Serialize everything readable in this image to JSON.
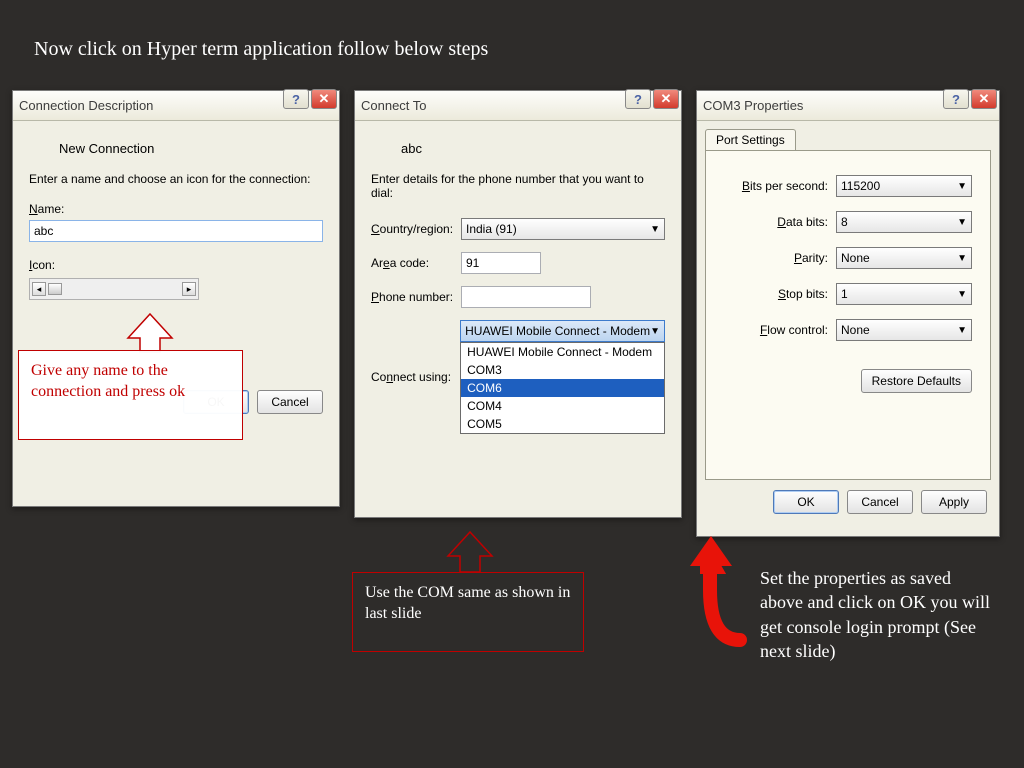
{
  "slide": {
    "title": "Now click on Hyper term application follow below steps"
  },
  "dialog1": {
    "title": "Connection Description",
    "subtitle": "New Connection",
    "prompt": "Enter a name and choose an icon for the connection:",
    "name_label": "Name:",
    "name_value": "abc",
    "icon_label": "Icon:",
    "ok": "OK",
    "cancel": "Cancel"
  },
  "dialog2": {
    "title": "Connect To",
    "subtitle": "abc",
    "prompt": "Enter details for the phone number that you want to dial:",
    "country_label": "Country/region:",
    "country_value": "India (91)",
    "area_label": "Area code:",
    "area_value": "91",
    "phone_label": "Phone number:",
    "phone_value": "",
    "connect_label": "Connect using:",
    "connect_value": "HUAWEI Mobile Connect - Modem",
    "options": [
      "HUAWEI Mobile Connect - Modem",
      "COM3",
      "COM6",
      "COM4",
      "COM5"
    ],
    "selected": "COM6"
  },
  "dialog3": {
    "title": "COM3 Properties",
    "tab": "Port Settings",
    "bits_label": "Bits per second:",
    "bits_value": "115200",
    "databits_label": "Data bits:",
    "databits_value": "8",
    "parity_label": "Parity:",
    "parity_value": "None",
    "stopbits_label": "Stop bits:",
    "stopbits_value": "1",
    "flow_label": "Flow control:",
    "flow_value": "None",
    "restore": "Restore Defaults",
    "ok": "OK",
    "cancel": "Cancel",
    "apply": "Apply"
  },
  "annot1": "Give any name to the connection and press ok",
  "annot2": "Use the COM same as shown in last slide",
  "annot3": "Set the properties as saved above and click on OK you will get console login prompt (See next slide)"
}
